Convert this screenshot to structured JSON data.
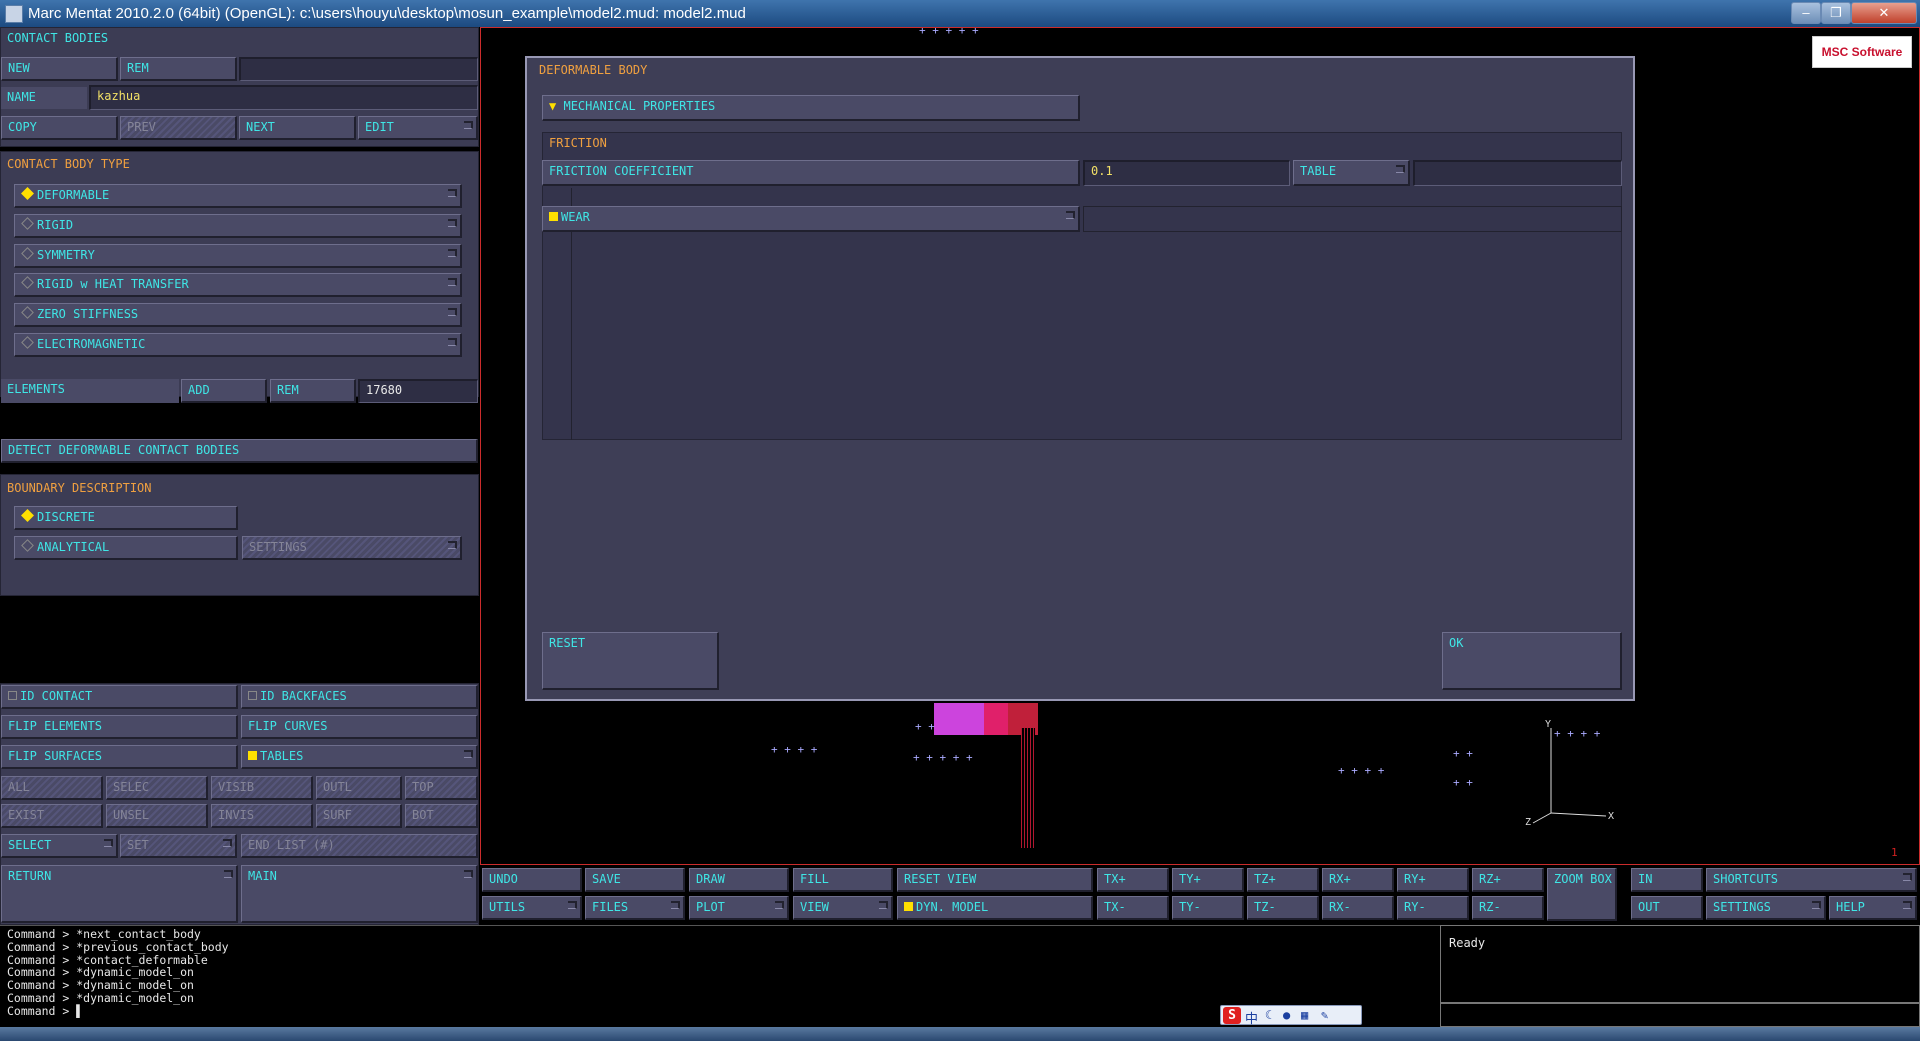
{
  "window": {
    "title": "Marc Mentat 2010.2.0 (64bit) (OpenGL): c:\\users\\houyu\\desktop\\mosun_example\\model2.mud: model2.mud",
    "minimize": "–",
    "maximize": "❐",
    "close": "✕"
  },
  "left": {
    "contact_bodies": "CONTACT BODIES",
    "new": "NEW",
    "rem": "REM",
    "name_label": "NAME",
    "name_value": "kazhua",
    "copy": "COPY",
    "prev": "PREV",
    "next": "NEXT",
    "edit": "EDIT",
    "contact_body_type": "CONTACT BODY TYPE",
    "types": [
      "DEFORMABLE",
      "RIGID",
      "SYMMETRY",
      "RIGID w HEAT TRANSFER",
      "ZERO STIFFNESS",
      "ELECTROMAGNETIC"
    ],
    "elements": "ELEMENTS",
    "add": "ADD",
    "rem2": "REM",
    "elements_count": "17680",
    "detect": "DETECT DEFORMABLE CONTACT BODIES",
    "boundary": "BOUNDARY DESCRIPTION",
    "discrete": "DISCRETE",
    "analytical": "ANALYTICAL",
    "settings": "SETTINGS",
    "id_contact": "ID CONTACT",
    "id_backfaces": "ID BACKFACES",
    "flip_elements": "FLIP ELEMENTS",
    "flip_curves": "FLIP CURVES",
    "flip_surfaces": "FLIP SURFACES",
    "tables": "TABLES",
    "grid1": [
      "ALL",
      "SELEC",
      "VISIB",
      "OUTL",
      "TOP"
    ],
    "grid2": [
      "EXIST",
      "UNSEL",
      "INVIS",
      "SURF",
      "BOT"
    ],
    "select": "SELECT",
    "set": "SET",
    "end_list": "END LIST (#)",
    "return": "RETURN",
    "main": "MAIN"
  },
  "dialog": {
    "title": "DEFORMABLE BODY",
    "mechanical": "MECHANICAL PROPERTIES",
    "friction": "FRICTION",
    "friction_coef_label": "FRICTION COEFFICIENT",
    "friction_coef_value": "0.1",
    "table": "TABLE",
    "wear": "WEAR",
    "reset": "RESET",
    "ok": "OK"
  },
  "viewport": {
    "logo": "MSC Software",
    "axis_y": "Y",
    "axis_x": "X",
    "axis_z": "Z",
    "counter": "1"
  },
  "toolbar": {
    "row1": [
      "UNDO",
      "SAVE",
      "DRAW",
      "FILL",
      "RESET VIEW",
      "TX+",
      "TY+",
      "TZ+",
      "RX+",
      "RY+",
      "RZ+",
      "ZOOM BOX",
      "IN",
      "SHORTCUTS"
    ],
    "row2": [
      "UTILS",
      "FILES",
      "PLOT",
      "VIEW",
      "DYN. MODEL",
      "TX-",
      "TY-",
      "TZ-",
      "RX-",
      "RY-",
      "RZ-",
      "OUT",
      "SETTINGS",
      "HELP"
    ]
  },
  "console": {
    "lines": [
      "Command > *next_contact_body",
      "Command > *previous_contact_body",
      "Command > *contact_deformable",
      "Command >  *dynamic_model_on",
      "Command >  *dynamic_model_on",
      "Command >  *dynamic_model_on",
      "Command > ▌"
    ],
    "status": "Ready"
  },
  "ime": {
    "logo": "S",
    "text": "中"
  }
}
